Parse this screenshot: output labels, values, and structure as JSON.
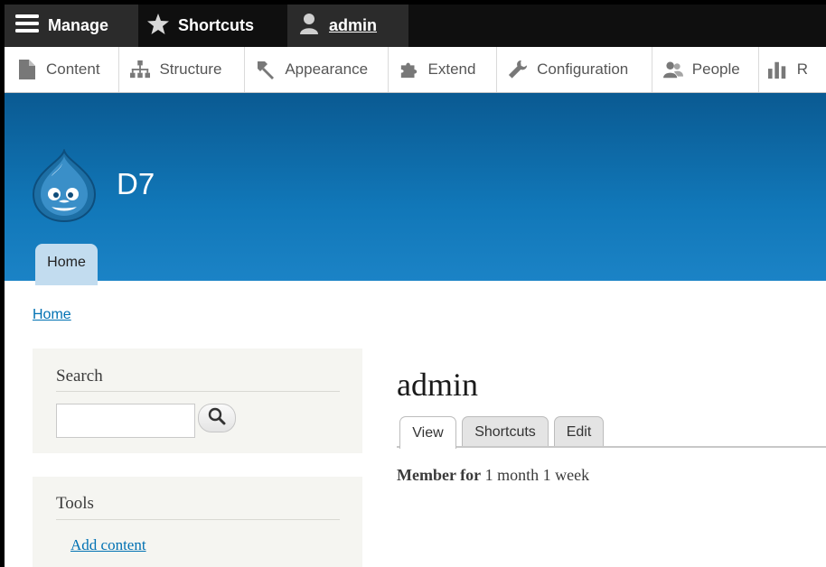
{
  "toolbar": {
    "manage_label": "Manage",
    "shortcuts_label": "Shortcuts",
    "user_label": "admin"
  },
  "tray": {
    "items": [
      {
        "label": "Content",
        "icon": "document-icon"
      },
      {
        "label": "Structure",
        "icon": "sitemap-icon"
      },
      {
        "label": "Appearance",
        "icon": "paintbrush-icon"
      },
      {
        "label": "Extend",
        "icon": "puzzle-icon"
      },
      {
        "label": "Configuration",
        "icon": "wrench-icon"
      },
      {
        "label": "People",
        "icon": "people-icon"
      },
      {
        "label": "R",
        "icon": "bar-chart-icon"
      }
    ]
  },
  "header": {
    "site_name": "D7",
    "primary_tab": "Home"
  },
  "breadcrumb": {
    "home": "Home"
  },
  "sidebar": {
    "search": {
      "title": "Search",
      "placeholder": ""
    },
    "tools": {
      "title": "Tools",
      "link": "Add content"
    }
  },
  "main": {
    "title": "admin",
    "tabs": [
      {
        "label": "View",
        "active": true
      },
      {
        "label": "Shortcuts",
        "active": false
      },
      {
        "label": "Edit",
        "active": false
      }
    ],
    "member_label": "Member for",
    "member_value": "1 month 1 week"
  },
  "colors": {
    "header_blue": "#1177b8",
    "link": "#0071b3",
    "toolbar": "#0f0f0f"
  }
}
